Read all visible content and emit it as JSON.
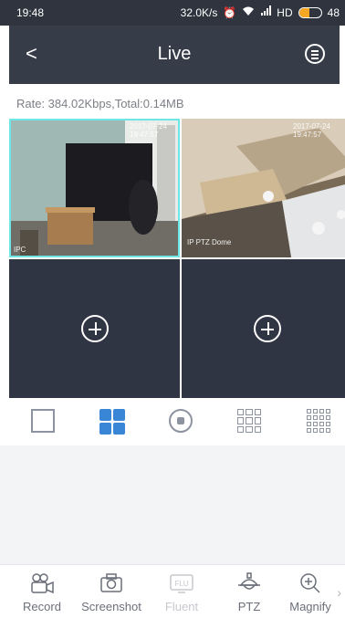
{
  "status_bar": {
    "time": "19:48",
    "network_speed": "32.0K/s",
    "network_label": "HD",
    "battery": "48"
  },
  "header": {
    "back_glyph": "<",
    "title": "Live",
    "menu_icon": "list-circle-icon"
  },
  "rate_text": "Rate: 384.02Kbps,Total:0.14MB",
  "channels": [
    {
      "label": "IPC",
      "timestamp": "2017-07-24 19:47:57",
      "state": "playing",
      "selected": true
    },
    {
      "label": "IP PTZ Dome",
      "timestamp": "2017-07-24 19:47:57",
      "state": "playing",
      "selected": false
    },
    {
      "state": "empty",
      "icon": "add-circle-icon"
    },
    {
      "state": "empty",
      "icon": "add-circle-icon"
    }
  ],
  "layout_options": [
    {
      "icon": "single-view-icon",
      "active": false
    },
    {
      "icon": "quad-view-icon",
      "active": true
    },
    {
      "icon": "stop-all-icon",
      "active": false
    },
    {
      "icon": "nine-view-icon",
      "active": false
    },
    {
      "icon": "sixteen-view-icon",
      "active": false
    }
  ],
  "toolbar": {
    "record": "Record",
    "screenshot": "Screenshot",
    "fluent": "Fluent",
    "fluent_badge": "FLU",
    "ptz": "PTZ",
    "magnify": "Magnify"
  },
  "colors": {
    "header_bg": "#363c48",
    "accent": "#3a86d6",
    "selected_border": "#6fe6e6"
  }
}
